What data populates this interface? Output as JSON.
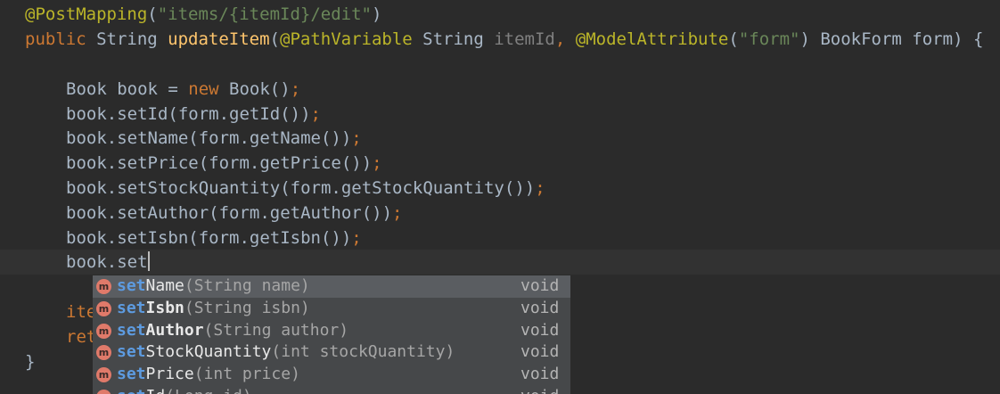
{
  "editor": {
    "line1": {
      "annotation": "@PostMapping",
      "open": "(",
      "string": "\"items/{itemId}/edit\"",
      "close": ")"
    },
    "line2": {
      "indent": "",
      "kw_public": "public ",
      "type_string": "String ",
      "method": "updateItem",
      "open": "(",
      "ann_path": "@PathVariable ",
      "type_string2": "String ",
      "param_itemId": "itemId",
      "comma": ", ",
      "ann_model": "@ModelAttribute",
      "open2": "(",
      "str_form": "\"form\"",
      "close2": ") ",
      "type_bookform": "BookForm form",
      "close": ") {"
    },
    "line3": {
      "text": "Book book = ",
      "kw_new": "new ",
      "ctor": "Book()",
      "semi": ";"
    },
    "line4": {
      "text": "book.setId(form.getId())",
      "semi": ";"
    },
    "line5": {
      "text": "book.setName(form.getName())",
      "semi": ";"
    },
    "line6": {
      "text": "book.setPrice(form.getPrice())",
      "semi": ";"
    },
    "line7": {
      "text": "book.setStockQuantity(form.getStockQuantity())",
      "semi": ";"
    },
    "line8": {
      "text": "book.setAuthor(form.getAuthor())",
      "semi": ";"
    },
    "line9": {
      "text": "book.setIsbn(form.getIsbn())",
      "semi": ";"
    },
    "line10": {
      "text": "book.set"
    },
    "line11": {
      "text": "ite"
    },
    "line12": {
      "text": "ret"
    },
    "line13": {
      "text": "}"
    }
  },
  "autocomplete": {
    "icon_letter": "m",
    "items": [
      {
        "prefix": "set",
        "rest": "Name",
        "params": "(String name)",
        "return": "void",
        "selected": true,
        "bold": false
      },
      {
        "prefix": "set",
        "rest": "Isbn",
        "params": "(String isbn)",
        "return": "void",
        "selected": false,
        "bold": true
      },
      {
        "prefix": "set",
        "rest": "Author",
        "params": "(String author)",
        "return": "void",
        "selected": false,
        "bold": true
      },
      {
        "prefix": "set",
        "rest": "StockQuantity",
        "params": "(int stockQuantity)",
        "return": "void",
        "selected": false,
        "bold": false
      },
      {
        "prefix": "set",
        "rest": "Price",
        "params": "(int price)",
        "return": "void",
        "selected": false,
        "bold": false
      },
      {
        "prefix": "set",
        "rest": "Id",
        "params": "(Long id)",
        "return": "void",
        "selected": false,
        "bold": false
      }
    ]
  },
  "colors": {
    "background": "#2b2b2b",
    "annotation": "#bbb529",
    "string": "#6a8759",
    "keyword": "#cc7832",
    "method": "#ffc66d",
    "parameter": "#808080",
    "popup_bg": "#46484a",
    "popup_selected": "#5a5d61",
    "match_prefix": "#5d9be0"
  }
}
